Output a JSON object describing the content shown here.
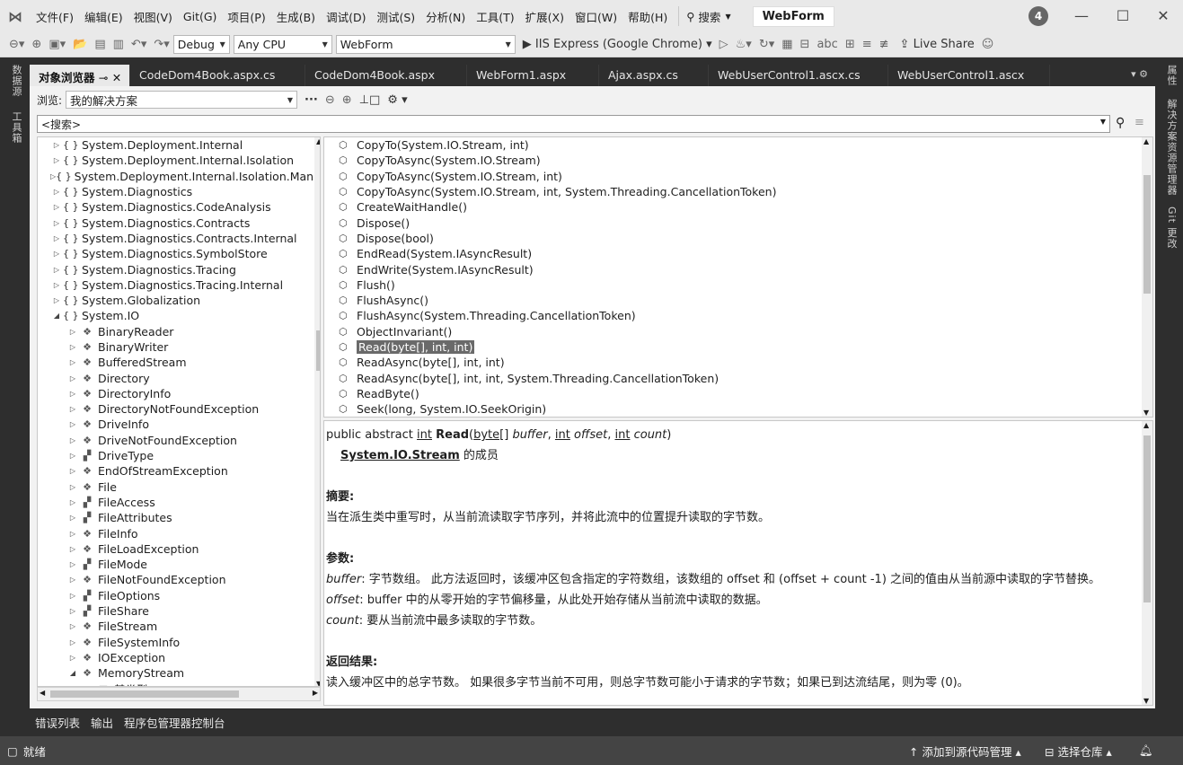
{
  "menu": [
    "文件(F)",
    "编辑(E)",
    "视图(V)",
    "Git(G)",
    "项目(P)",
    "生成(B)",
    "调试(D)",
    "测试(S)",
    "分析(N)",
    "工具(T)",
    "扩展(X)",
    "窗口(W)",
    "帮助(H)"
  ],
  "search_label": "搜索",
  "solution_name": "WebForm",
  "notifications": "4",
  "toolbar": {
    "config": "Debug",
    "platform": "Any CPU",
    "project": "WebForm",
    "run_target": "IIS Express (Google Chrome)",
    "live_share": "Live Share"
  },
  "left_tool_tabs": [
    "数据源",
    "工具箱"
  ],
  "right_tool_tabs": [
    "属性",
    "解决方案资源管理器",
    "Git 更改"
  ],
  "doc_tabs": [
    "对象浏览器",
    "CodeDom4Book.aspx.cs",
    "CodeDom4Book.aspx",
    "WebForm1.aspx",
    "Ajax.aspx.cs",
    "WebUserControl1.ascx.cs",
    "WebUserControl1.ascx"
  ],
  "browse": {
    "label": "浏览:",
    "scope": "我的解决方案",
    "more": "···"
  },
  "search_placeholder": "<搜索>",
  "tree": [
    {
      "t": "System.Deployment.Internal",
      "k": "ns",
      "d": 0,
      "e": "closed"
    },
    {
      "t": "System.Deployment.Internal.Isolation",
      "k": "ns",
      "d": 0,
      "e": "closed"
    },
    {
      "t": "System.Deployment.Internal.Isolation.Manif",
      "k": "ns",
      "d": 0,
      "e": "closed"
    },
    {
      "t": "System.Diagnostics",
      "k": "ns",
      "d": 0,
      "e": "closed"
    },
    {
      "t": "System.Diagnostics.CodeAnalysis",
      "k": "ns",
      "d": 0,
      "e": "closed"
    },
    {
      "t": "System.Diagnostics.Contracts",
      "k": "ns",
      "d": 0,
      "e": "closed"
    },
    {
      "t": "System.Diagnostics.Contracts.Internal",
      "k": "ns",
      "d": 0,
      "e": "closed"
    },
    {
      "t": "System.Diagnostics.SymbolStore",
      "k": "ns",
      "d": 0,
      "e": "closed"
    },
    {
      "t": "System.Diagnostics.Tracing",
      "k": "ns",
      "d": 0,
      "e": "closed"
    },
    {
      "t": "System.Diagnostics.Tracing.Internal",
      "k": "ns",
      "d": 0,
      "e": "closed"
    },
    {
      "t": "System.Globalization",
      "k": "ns",
      "d": 0,
      "e": "closed"
    },
    {
      "t": "System.IO",
      "k": "ns",
      "d": 0,
      "e": "open"
    },
    {
      "t": "BinaryReader",
      "k": "cls",
      "d": 1,
      "e": "closed"
    },
    {
      "t": "BinaryWriter",
      "k": "cls",
      "d": 1,
      "e": "closed"
    },
    {
      "t": "BufferedStream",
      "k": "cls",
      "d": 1,
      "e": "closed"
    },
    {
      "t": "Directory",
      "k": "cls",
      "d": 1,
      "e": "closed"
    },
    {
      "t": "DirectoryInfo",
      "k": "cls",
      "d": 1,
      "e": "closed"
    },
    {
      "t": "DirectoryNotFoundException",
      "k": "cls",
      "d": 1,
      "e": "closed"
    },
    {
      "t": "DriveInfo",
      "k": "cls",
      "d": 1,
      "e": "closed"
    },
    {
      "t": "DriveNotFoundException",
      "k": "cls",
      "d": 1,
      "e": "closed"
    },
    {
      "t": "DriveType",
      "k": "enum",
      "d": 1,
      "e": "closed"
    },
    {
      "t": "EndOfStreamException",
      "k": "cls",
      "d": 1,
      "e": "closed"
    },
    {
      "t": "File",
      "k": "cls",
      "d": 1,
      "e": "closed"
    },
    {
      "t": "FileAccess",
      "k": "enum",
      "d": 1,
      "e": "closed"
    },
    {
      "t": "FileAttributes",
      "k": "enum",
      "d": 1,
      "e": "closed"
    },
    {
      "t": "FileInfo",
      "k": "cls",
      "d": 1,
      "e": "closed"
    },
    {
      "t": "FileLoadException",
      "k": "cls",
      "d": 1,
      "e": "closed"
    },
    {
      "t": "FileMode",
      "k": "enum",
      "d": 1,
      "e": "closed"
    },
    {
      "t": "FileNotFoundException",
      "k": "cls",
      "d": 1,
      "e": "closed"
    },
    {
      "t": "FileOptions",
      "k": "enum",
      "d": 1,
      "e": "closed"
    },
    {
      "t": "FileShare",
      "k": "enum",
      "d": 1,
      "e": "closed"
    },
    {
      "t": "FileStream",
      "k": "cls",
      "d": 1,
      "e": "closed"
    },
    {
      "t": "FileSystemInfo",
      "k": "cls",
      "d": 1,
      "e": "closed"
    },
    {
      "t": "IOException",
      "k": "cls",
      "d": 1,
      "e": "closed"
    },
    {
      "t": "MemoryStream",
      "k": "cls",
      "d": 1,
      "e": "open"
    },
    {
      "t": "基类型",
      "k": "folder",
      "d": 2,
      "e": "closed"
    }
  ],
  "members": [
    {
      "t": "CopyTo(System.IO.Stream, int)",
      "sel": false
    },
    {
      "t": "CopyToAsync(System.IO.Stream)",
      "sel": false
    },
    {
      "t": "CopyToAsync(System.IO.Stream, int)",
      "sel": false
    },
    {
      "t": "CopyToAsync(System.IO.Stream, int, System.Threading.CancellationToken)",
      "sel": false
    },
    {
      "t": "CreateWaitHandle()",
      "sel": false
    },
    {
      "t": "Dispose()",
      "sel": false
    },
    {
      "t": "Dispose(bool)",
      "sel": false
    },
    {
      "t": "EndRead(System.IAsyncResult)",
      "sel": false
    },
    {
      "t": "EndWrite(System.IAsyncResult)",
      "sel": false
    },
    {
      "t": "Flush()",
      "sel": false
    },
    {
      "t": "FlushAsync()",
      "sel": false
    },
    {
      "t": "FlushAsync(System.Threading.CancellationToken)",
      "sel": false
    },
    {
      "t": "ObjectInvariant()",
      "sel": false
    },
    {
      "t": "Read(byte[], int, int)",
      "sel": true
    },
    {
      "t": "ReadAsync(byte[], int, int)",
      "sel": false
    },
    {
      "t": "ReadAsync(byte[], int, int, System.Threading.CancellationToken)",
      "sel": false
    },
    {
      "t": "ReadByte()",
      "sel": false
    },
    {
      "t": "Seek(long, System.IO.SeekOrigin)",
      "sel": false
    }
  ],
  "desc": {
    "sig_prefix": "public abstract ",
    "sig_int": "int",
    "sig_name": "Read",
    "sig_byte": "byte[]",
    "p1": "buffer",
    "p2": "offset",
    "p3": "count",
    "member_of_link": "System.IO.Stream",
    "member_of_suffix": " 的成员",
    "summary_h": "摘要:",
    "summary": "当在派生类中重写时，从当前流读取字节序列，并将此流中的位置提升读取的字节数。",
    "params_h": "参数:",
    "param1_name": "buffer",
    "param1_text": ": 字节数组。 此方法返回时，该缓冲区包含指定的字符数组，该数组的 offset 和 (offset + count -1) 之间的值由从当前源中读取的字节替换。",
    "param2_name": "offset",
    "param2_text": ": buffer 中的从零开始的字节偏移量，从此处开始存储从当前流中读取的数据。",
    "param3_name": "count",
    "param3_text": ": 要从当前流中最多读取的字节数。",
    "returns_h": "返回结果:",
    "returns": "读入缓冲区中的总字节数。 如果很多字节当前不可用，则总字节数可能小于请求的字节数；如果已到达流结尾，则为零 (0)。"
  },
  "bottom_tabs": [
    "错误列表",
    "输出",
    "程序包管理器控制台"
  ],
  "status": {
    "ready": "就绪",
    "source_control": "添加到源代码管理",
    "repo": "选择仓库"
  }
}
